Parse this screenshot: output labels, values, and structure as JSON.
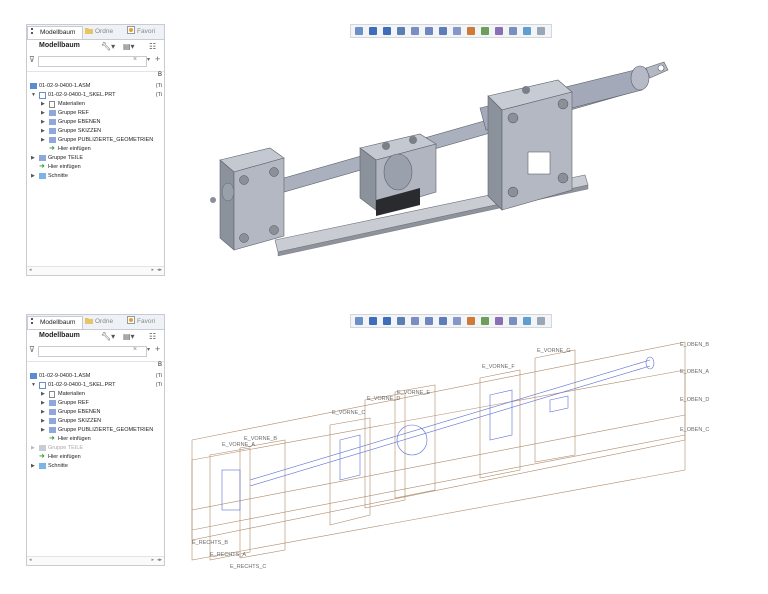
{
  "panels": [
    {
      "tabs": [
        "Modellbaum",
        "Ordne",
        "Favori"
      ],
      "toolbar_title": "Modellbaum",
      "filter_placeholder": "",
      "column_header": "B",
      "tree": [
        {
          "label": "01-02-9-0400-1.ASM",
          "status": "(Ti"
        },
        {
          "label": "01-02-9-0400-1_SKEL.PRT",
          "status": "(Ti"
        },
        {
          "label": "Materialien"
        },
        {
          "label": "Gruppe REF"
        },
        {
          "label": "Gruppe EBENEN"
        },
        {
          "label": "Gruppe SKIZZEN"
        },
        {
          "label": "Gruppe PUBLIZIERTE_GEOMETRIEN"
        },
        {
          "label": "Hier einfügen"
        },
        {
          "label": "Gruppe TEILE"
        },
        {
          "label": "Hier einfügen"
        },
        {
          "label": "Schnitte"
        }
      ],
      "teile_dimmed": false
    },
    {
      "tabs": [
        "Modellbaum",
        "Ordne",
        "Favori"
      ],
      "toolbar_title": "Modellbaum",
      "filter_placeholder": "",
      "column_header": "B",
      "tree": [
        {
          "label": "01-02-9-0400-1.ASM",
          "status": "(Ti"
        },
        {
          "label": "01-02-9-0400-1_SKEL.PRT",
          "status": "(Ti"
        },
        {
          "label": "Materialien"
        },
        {
          "label": "Gruppe REF"
        },
        {
          "label": "Gruppe EBENEN"
        },
        {
          "label": "Gruppe SKIZZEN"
        },
        {
          "label": "Gruppe PUBLIZIERTE_GEOMETRIEN"
        },
        {
          "label": "Hier einfügen"
        },
        {
          "label": "Gruppe TEILE"
        },
        {
          "label": "Hier einfügen"
        },
        {
          "label": "Schnitte"
        }
      ],
      "teile_dimmed": true
    }
  ],
  "view_toolbar_icons": [
    "refit-icon",
    "zoom-in-icon",
    "zoom-out-icon",
    "repaint-icon",
    "display-style-icon",
    "saved-orientation-icon",
    "named-views-icon",
    "view-manager-icon",
    "perspective-icon",
    "datum-display-icon",
    "spin-center-icon",
    "annotation-display-icon",
    "section-icon",
    "appearance-icon"
  ],
  "plane_labels": [
    "E_OBEN_B",
    "E_OBEN_A",
    "E_OBEN_D",
    "E_OBEN_C",
    "E_VORNE_G",
    "E_VORNE_F",
    "E_VORNE_E",
    "E_VORNE_D",
    "E_VORNE_C",
    "E_VORNE_B",
    "E_VORNE_A",
    "E_RECHTS_B",
    "E_RECHTS_A",
    "E_RECHTS_C"
  ],
  "colors": {
    "accent": "#3a6fb0",
    "model_gray": "#9ea3ad",
    "plane_brown": "#b08a6a",
    "sketch_blue": "#5a6fd6"
  }
}
